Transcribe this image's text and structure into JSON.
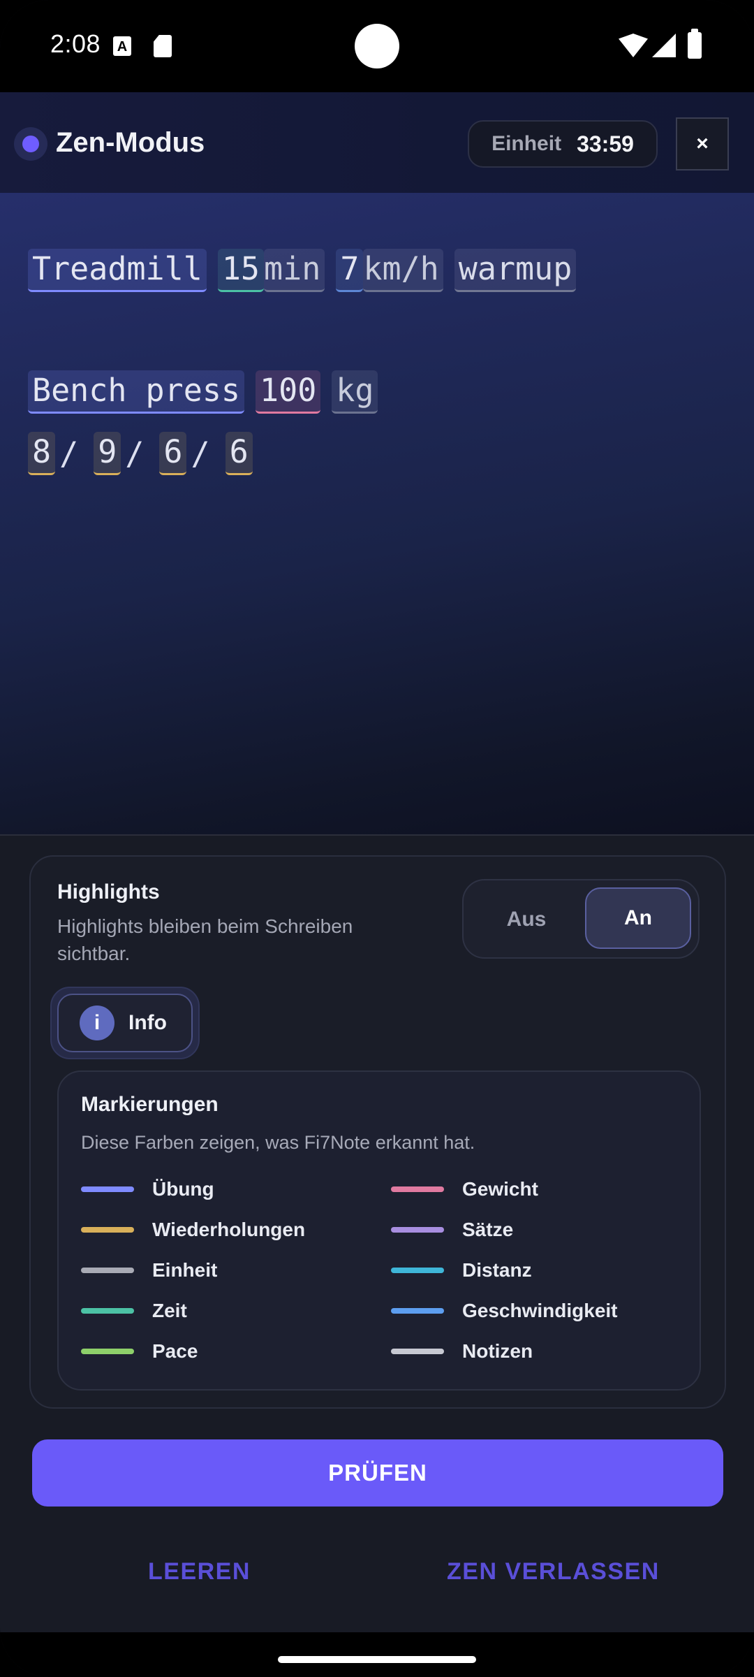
{
  "status_bar": {
    "time": "2:08",
    "icons": [
      "font-a-icon",
      "sd-card-icon",
      "wifi-icon",
      "signal-icon",
      "battery-icon"
    ]
  },
  "app_bar": {
    "title": "Zen-Modus",
    "unit_label": "Einheit",
    "unit_timer": "33:59",
    "close_label": "×"
  },
  "editor": {
    "line1": {
      "exercise": "Treadmill",
      "duration_value": "15",
      "duration_unit": "min",
      "speed_value": "7",
      "speed_unit": "km/h",
      "note": "warmup"
    },
    "line2": {
      "exercise": "Bench press",
      "weight_value": "100",
      "weight_unit": "kg"
    },
    "line3": {
      "reps": [
        "8",
        "9",
        "6",
        "6"
      ],
      "separator": "/"
    }
  },
  "highlights": {
    "title": "Highlights",
    "description": "Highlights bleiben beim Schreiben sichtbar.",
    "toggle_off": "Aus",
    "toggle_on": "An",
    "selected": "An"
  },
  "info": {
    "icon_letter": "i",
    "label": "Info"
  },
  "legend": {
    "title": "Markierungen",
    "description": "Diese Farben zeigen, was Fi7Note erkannt hat.",
    "items": [
      {
        "name": "Übung",
        "color": "#7f8bff"
      },
      {
        "name": "Gewicht",
        "color": "#e07aa0"
      },
      {
        "name": "Wiederholungen",
        "color": "#d9b05a"
      },
      {
        "name": "Sätze",
        "color": "#a88ee0"
      },
      {
        "name": "Einheit",
        "color": "#a9abb5"
      },
      {
        "name": "Distanz",
        "color": "#3fb6d8"
      },
      {
        "name": "Zeit",
        "color": "#4cc2a5"
      },
      {
        "name": "Geschwindigkeit",
        "color": "#5d9ef0"
      },
      {
        "name": "Pace",
        "color": "#8ed06a"
      },
      {
        "name": "Notizen",
        "color": "#c7c9d2"
      }
    ]
  },
  "actions": {
    "check": "PRÜFEN",
    "clear": "LEEREN",
    "exit_zen": "ZEN VERLASSEN"
  },
  "colors": {
    "accent": "#6a5af9",
    "secondary_text_button": "#5a4fd8"
  }
}
